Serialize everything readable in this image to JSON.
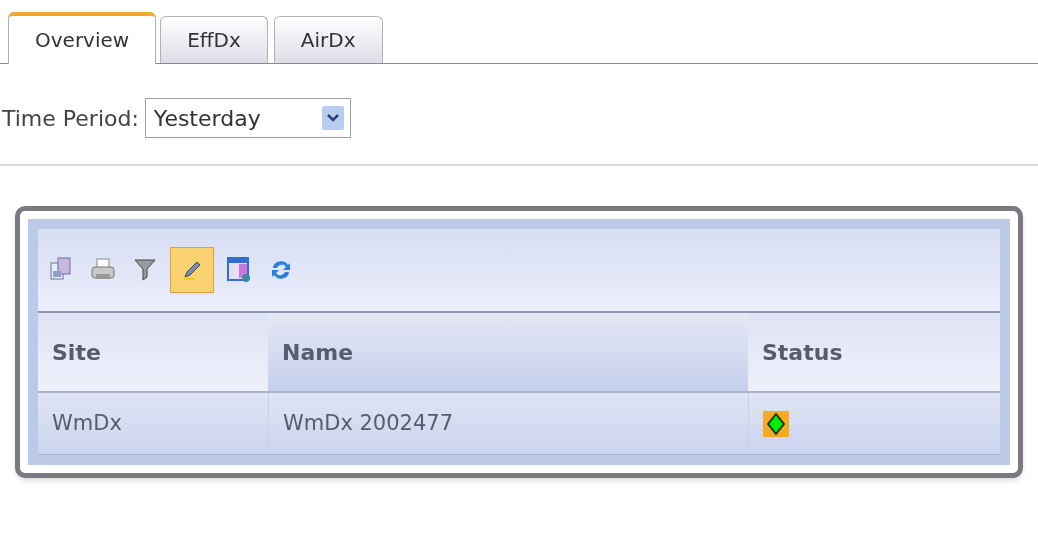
{
  "tabs": [
    {
      "label": "Overview",
      "selected": true
    },
    {
      "label": "EffDx",
      "selected": false
    },
    {
      "label": "AirDx",
      "selected": false
    }
  ],
  "time_period": {
    "label": "Time Period:",
    "value": "Yesterday"
  },
  "toolbar": [
    {
      "kind": "copy",
      "selected": false
    },
    {
      "kind": "print",
      "selected": false
    },
    {
      "kind": "filter",
      "selected": false
    },
    {
      "kind": "edit",
      "selected": true
    },
    {
      "kind": "view",
      "selected": false
    },
    {
      "kind": "refresh",
      "selected": false
    }
  ],
  "table": {
    "columns": [
      "Site",
      "Name",
      "Status"
    ],
    "rows": [
      {
        "site": "WmDx",
        "name": "WmDx 2002477",
        "color": "#00ee00"
      }
    ]
  }
}
